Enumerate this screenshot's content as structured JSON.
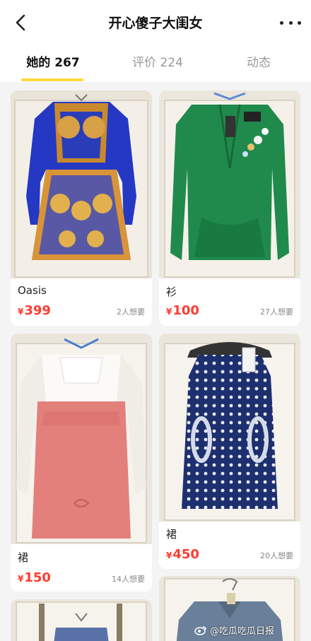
{
  "header": {
    "title": "开心傻子大闺女",
    "back_icon": "chevron-left-icon",
    "more_icon": "more-dots-icon"
  },
  "tabs": [
    {
      "label": "她的 267",
      "active": true
    },
    {
      "label": "评价 224",
      "active": false
    },
    {
      "label": "动态",
      "active": false
    }
  ],
  "items": [
    {
      "name": "Oasis",
      "currency": "¥",
      "price": "399",
      "wants": "2人想要"
    },
    {
      "name": "衫",
      "currency": "¥",
      "price": "100",
      "wants": "27人想要"
    },
    {
      "name": "裙",
      "currency": "¥",
      "price": "150",
      "wants": "14人想要"
    },
    {
      "name": "裙",
      "currency": "¥",
      "price": "450",
      "wants": "20人想要"
    }
  ],
  "watermark": "@吃瓜吃瓜日报",
  "colors": {
    "accent": "#ffd83b",
    "price": "#ff3b30"
  }
}
